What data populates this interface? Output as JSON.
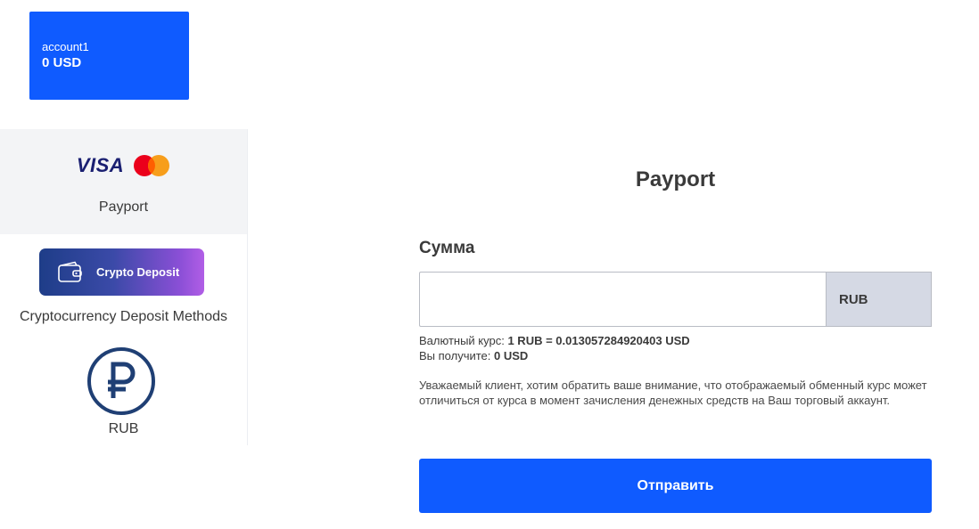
{
  "account": {
    "name": "account1",
    "balance": "0 USD"
  },
  "sidebar": {
    "methods": [
      {
        "label": "Payport",
        "logos": [
          "visa-logo",
          "mastercard-logo"
        ],
        "visa_text": "VISA",
        "selected": true
      },
      {
        "label": "Cryptocurrency Deposit Methods",
        "badge_text": "Crypto Deposit",
        "icon": "wallet-icon"
      },
      {
        "label": "RUB",
        "icon": "ruble-icon"
      }
    ]
  },
  "form": {
    "title": "Payport",
    "amount_label": "Сумма",
    "amount_value": "",
    "currency": "RUB",
    "rate_prefix": "Валютный курс:",
    "rate_value": "1 RUB = 0.013057284920403 USD",
    "receive_prefix": "Вы получите:",
    "receive_value": "0 USD",
    "notice": "Уважаемый клиент, хотим обратить ваше внимание, что отображаемый обменный курс может отличиться от курса в момент зачисления денежных средств на Ваш торговый аккаунт.",
    "submit_label": "Отправить"
  },
  "colors": {
    "accent": "#0f5bff",
    "visa": "#1a1f71",
    "ruble": "#1f3f74"
  }
}
